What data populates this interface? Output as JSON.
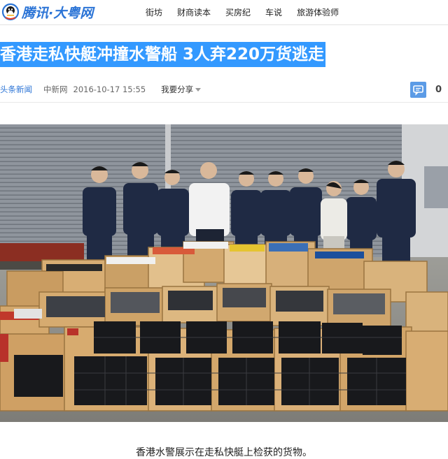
{
  "header": {
    "logo_text": "腾讯·大粤网",
    "nav": [
      "街坊",
      "财商读本",
      "买房纪",
      "车说",
      "旅游体验师"
    ]
  },
  "article": {
    "title": "香港走私快艇冲撞水警船 3人弃220万货逃走",
    "channel": "头条新闻",
    "source": "中新网",
    "date": "2016-10-17  15:55",
    "share_label": "我要分享",
    "comment_count": "0",
    "caption": "香港水警展示在走私快艇上检获的货物。"
  },
  "colors": {
    "brand_blue": "#2b74d6",
    "title_highlight": "#3399ff",
    "comment_icon": "#5b9be6"
  },
  "icons": {
    "logo": "tencent-penguin-icon",
    "share_dropdown": "caret-down-icon",
    "comment": "comment-bubble-icon"
  }
}
